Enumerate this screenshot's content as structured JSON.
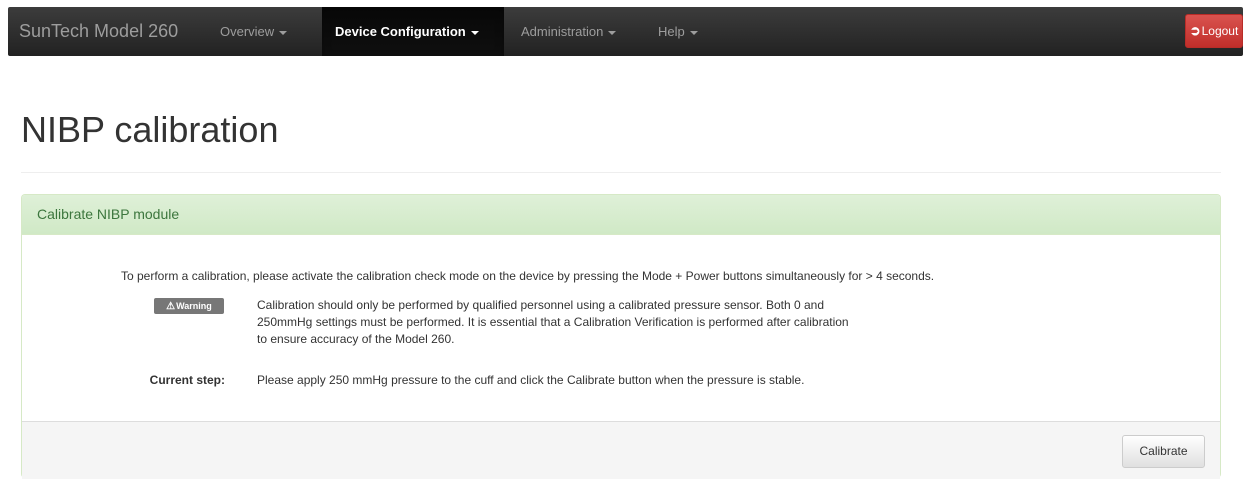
{
  "navbar": {
    "brand": "SunTech Model 260",
    "items": [
      {
        "label": "Overview"
      },
      {
        "label": "Device Configuration"
      },
      {
        "label": "Administration"
      },
      {
        "label": "Help"
      }
    ],
    "logout_label": "Logout",
    "logout_icon": "logout-arrow-icon"
  },
  "page": {
    "title": "NIBP calibration"
  },
  "panel": {
    "title": "Calibrate NIBP module",
    "intro": "To perform a calibration, please activate the calibration check mode on the device by pressing the Mode + Power buttons simultaneously for > 4 seconds.",
    "warning_badge": "Warning",
    "warning_lines": [
      "Calibration should only be performed by qualified personnel using a calibrated pressure sensor. Both 0 and",
      "250mmHg settings must be performed. It is essential that a Calibration Verification is performed after calibration",
      "to ensure accuracy of the Model 260."
    ],
    "current_step_label": "Current step:",
    "current_step_text": "Please apply 250 mmHg pressure to the cuff and click the Calibrate button when the pressure is stable.",
    "calibrate_label": "Calibrate"
  },
  "colors": {
    "navbar_bg": "#222222",
    "logout_red": "#d9534f",
    "panel_heading_bg": "#dff0d8",
    "panel_title_green": "#3c763d",
    "badge_gray": "#777777"
  }
}
